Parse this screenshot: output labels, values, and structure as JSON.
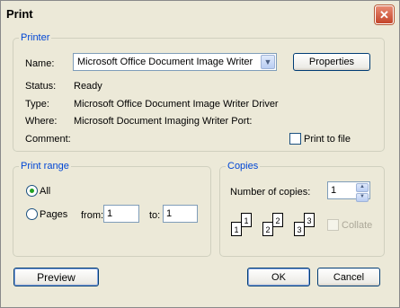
{
  "window": {
    "title": "Print"
  },
  "printer": {
    "legend": "Printer",
    "name_label": "Name:",
    "name_value": "Microsoft Office Document Image Writer",
    "properties_label": "Properties",
    "status_label": "Status:",
    "status_value": "Ready",
    "type_label": "Type:",
    "type_value": "Microsoft Office Document Image Writer Driver",
    "where_label": "Where:",
    "where_value": "Microsoft Document Imaging Writer Port:",
    "comment_label": "Comment:",
    "print_to_file_label": "Print to file",
    "print_to_file_checked": false
  },
  "print_range": {
    "legend": "Print range",
    "all_label": "All",
    "pages_label": "Pages",
    "selected": "All",
    "from_label": "from:",
    "from_value": "1",
    "to_label": "to:",
    "to_value": "1"
  },
  "copies": {
    "legend": "Copies",
    "count_label": "Number of copies:",
    "count_value": "1",
    "collate_label": "Collate",
    "collate_enabled": false,
    "collate_pages": [
      "1",
      "1",
      "2",
      "2",
      "3",
      "3"
    ]
  },
  "buttons": {
    "preview": "Preview",
    "ok": "OK",
    "cancel": "Cancel"
  }
}
